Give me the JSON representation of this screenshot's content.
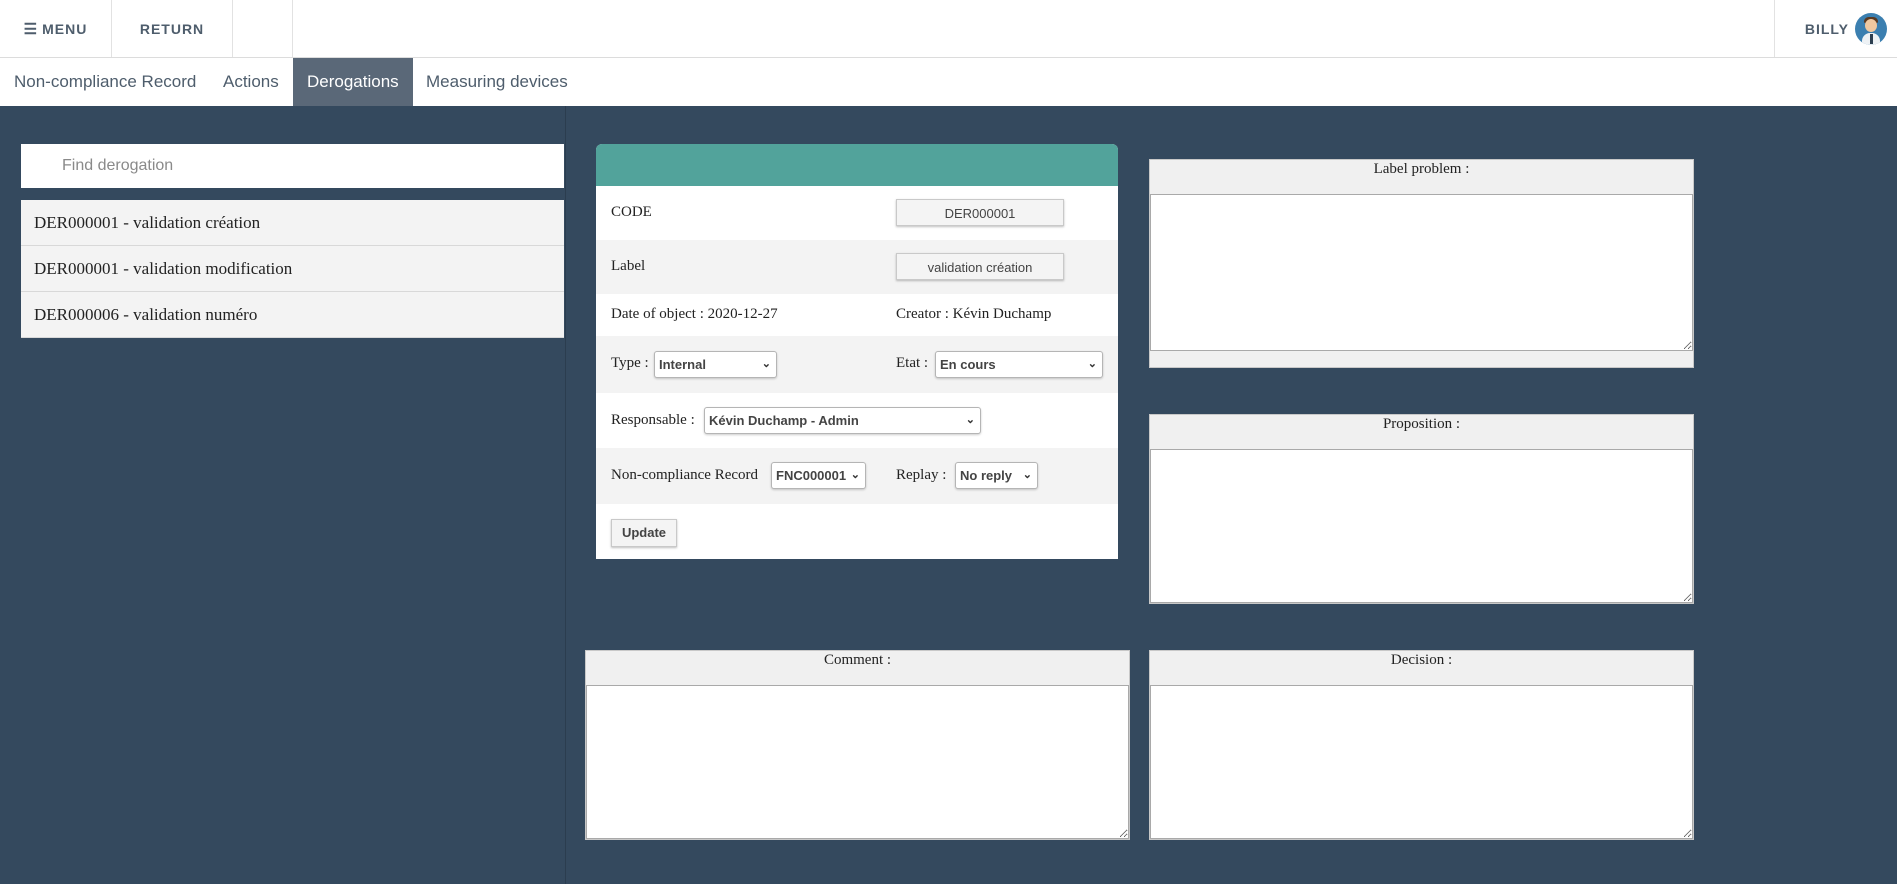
{
  "topbar": {
    "menu_label": "MENU",
    "return_label": "RETURN",
    "user_name": "BILLY"
  },
  "tabs": [
    {
      "label": "Non-compliance Record",
      "active": false
    },
    {
      "label": "Actions",
      "active": false
    },
    {
      "label": "Derogations",
      "active": true
    },
    {
      "label": "Measuring devices",
      "active": false
    }
  ],
  "search": {
    "placeholder": "Find derogation",
    "value": ""
  },
  "derogations": [
    {
      "label": "DER000001 - validation création"
    },
    {
      "label": "DER000001 - validation modification"
    },
    {
      "label": "DER000006 - validation numéro"
    }
  ],
  "form": {
    "code_label": "CODE",
    "code_value": "DER000001",
    "label_label": "Label",
    "label_value": "validation création",
    "date_text": "Date of object : 2020-12-27",
    "creator_text": "Creator : Kévin Duchamp",
    "type_label": "Type :",
    "type_value": "Internal",
    "etat_label": "Etat :",
    "etat_value": "En cours",
    "responsable_label": "Responsable :",
    "responsable_value": "Kévin Duchamp - Admin",
    "ncr_label": "Non-compliance Record",
    "ncr_value": "FNC000001",
    "replay_label": "Replay :",
    "replay_value": "No reply",
    "update_label": "Update"
  },
  "textareas": {
    "label_problem_title": "Label problem :",
    "proposition_title": "Proposition :",
    "comment_title": "Comment :",
    "decision_title": "Decision :"
  },
  "colors": {
    "background": "#34495e",
    "card_header": "#52a39b",
    "active_tab": "#5a6878"
  }
}
